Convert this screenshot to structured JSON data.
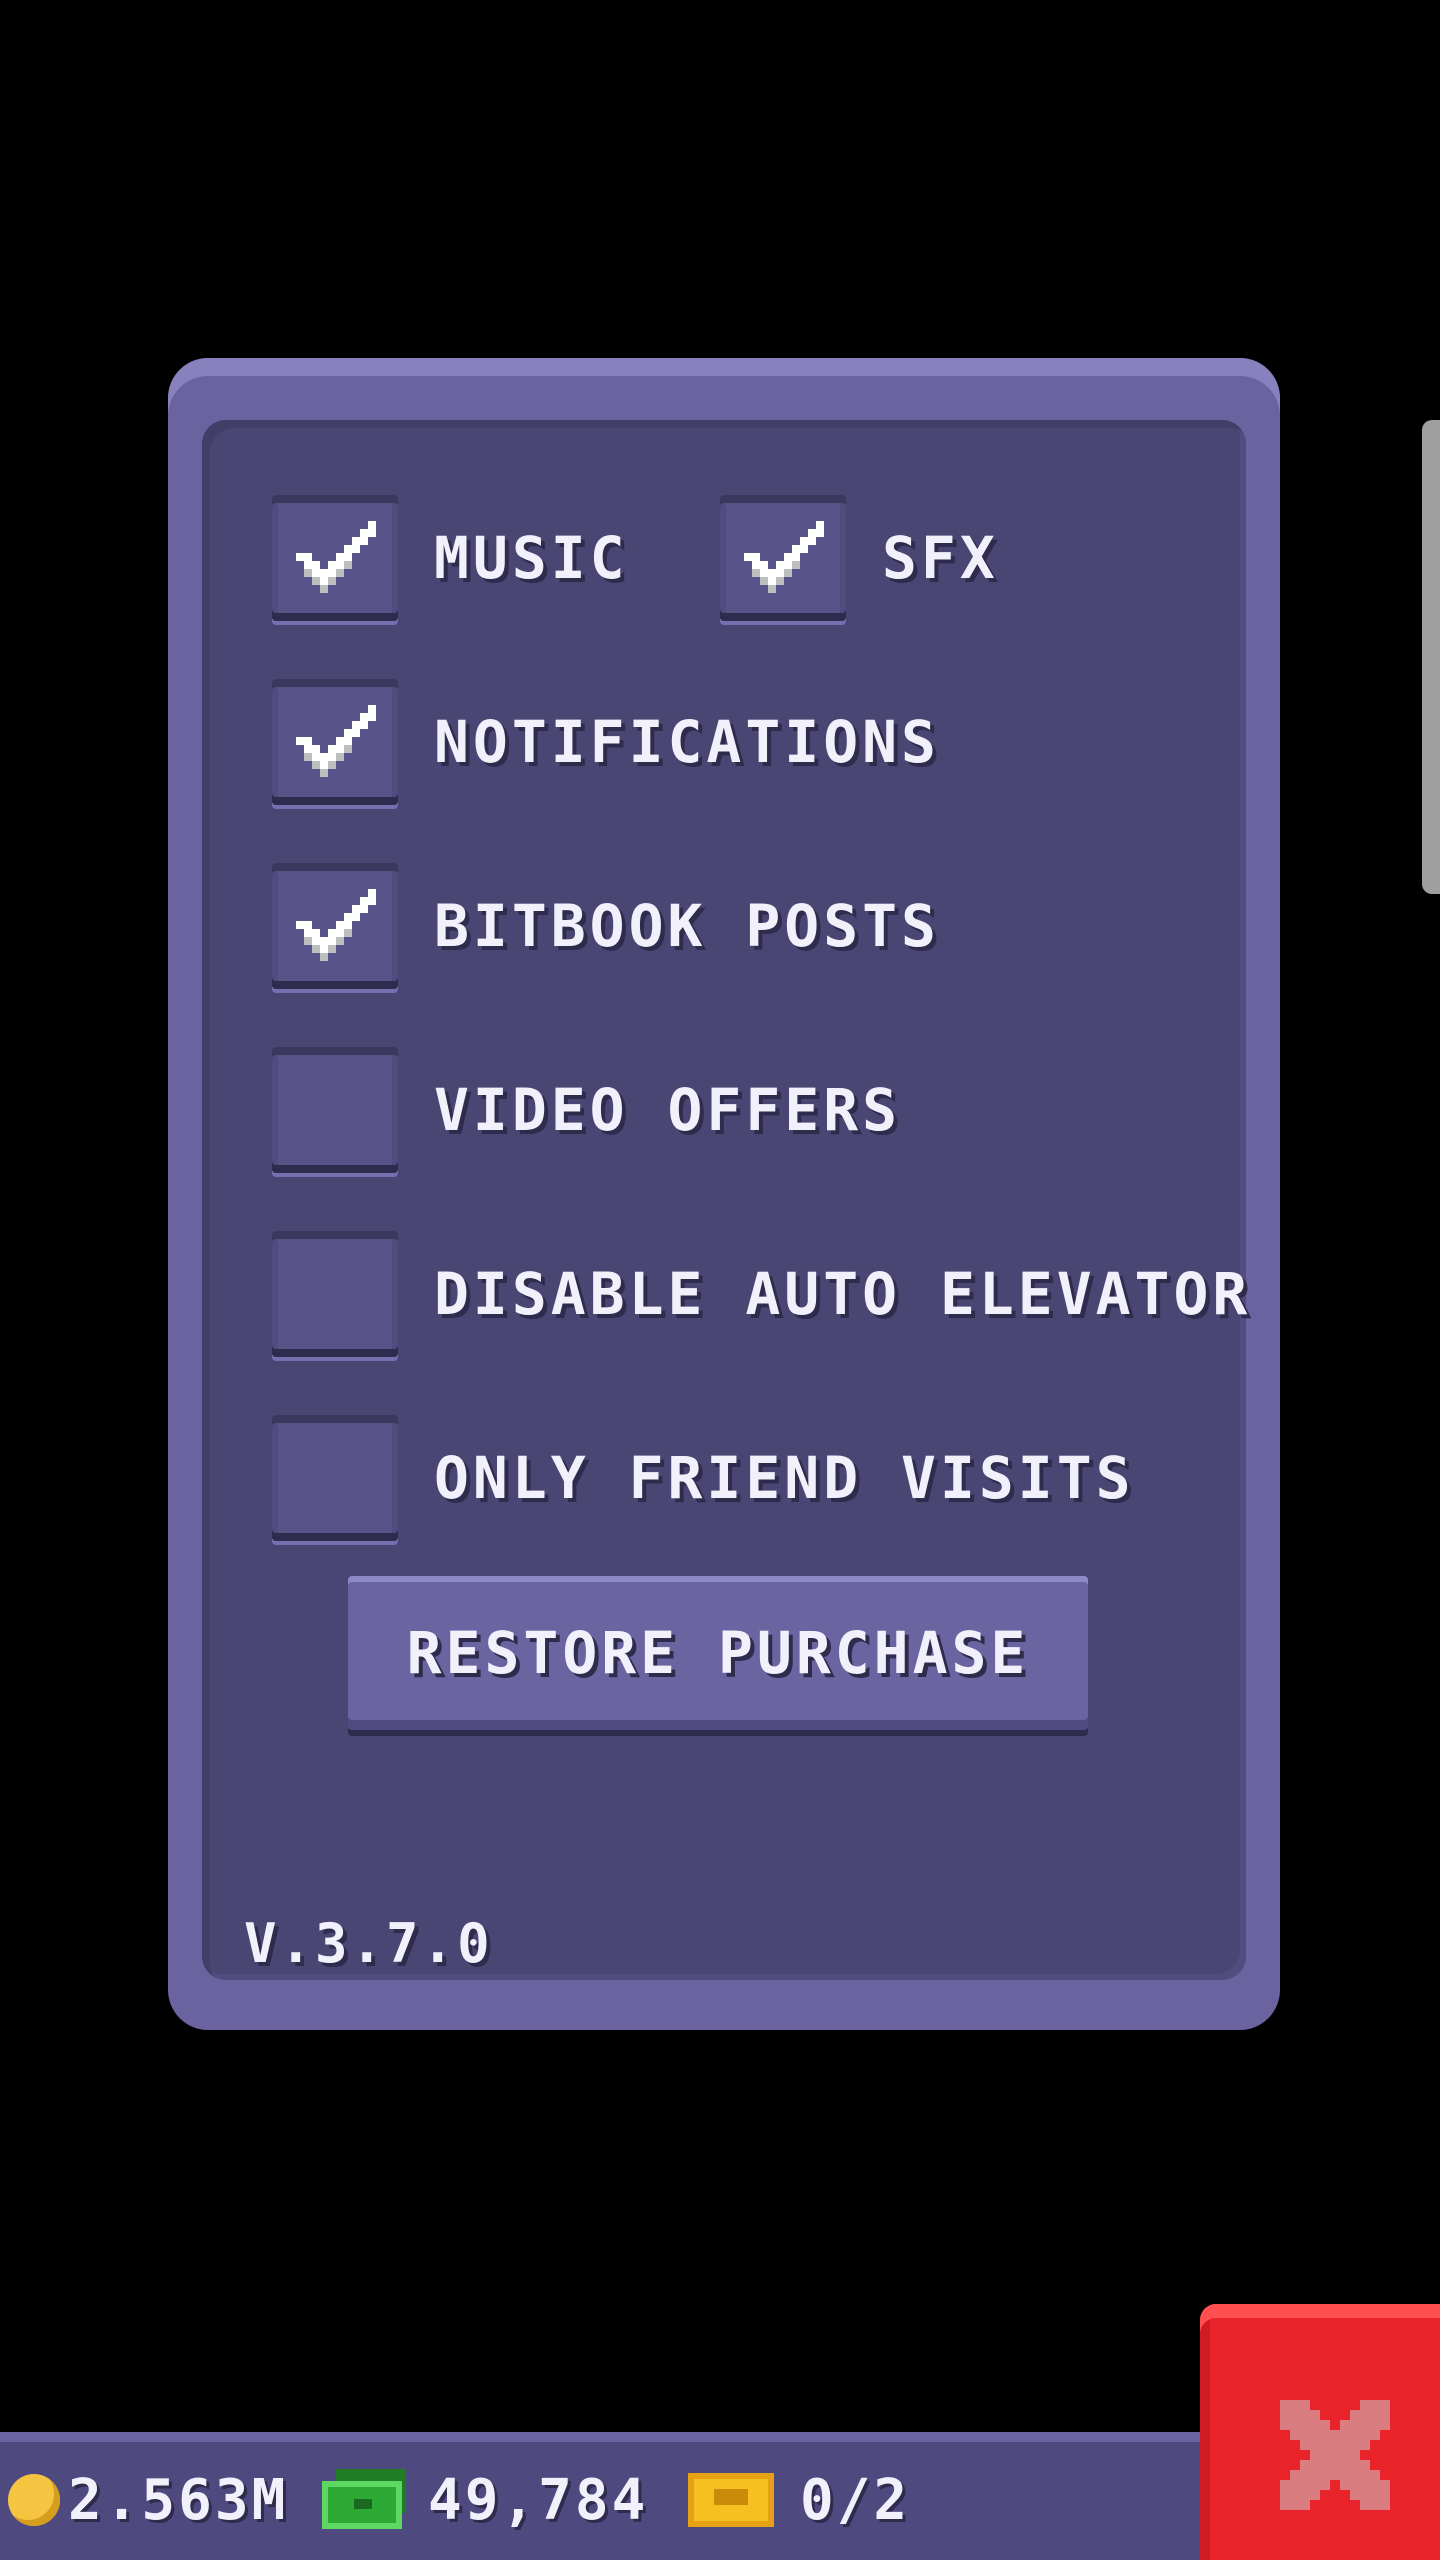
{
  "settings": {
    "options": [
      {
        "label": "MUSIC",
        "checked": true
      },
      {
        "label": "SFX",
        "checked": true
      },
      {
        "label": "NOTIFICATIONS",
        "checked": true
      },
      {
        "label": "BITBOOK POSTS",
        "checked": true
      },
      {
        "label": "VIDEO OFFERS",
        "checked": false
      },
      {
        "label": "DISABLE AUTO ELEVATOR",
        "checked": false
      },
      {
        "label": "ONLY FRIEND VISITS",
        "checked": false
      }
    ],
    "restore_label": "RESTORE PURCHASE",
    "version": "V.3.7.0"
  },
  "resources": {
    "coins": "2.563M",
    "bux": "49,784",
    "tickets": "0/2"
  },
  "icons": {
    "check": "check-icon",
    "close": "close-icon",
    "coin": "coin-icon",
    "bux": "bux-icon",
    "ticket": "ticket-icon"
  },
  "colors": {
    "panel": "#6a639f",
    "panel_inner": "#494673",
    "close_button": "#e8232a",
    "resource_bar": "#4e4a80"
  }
}
